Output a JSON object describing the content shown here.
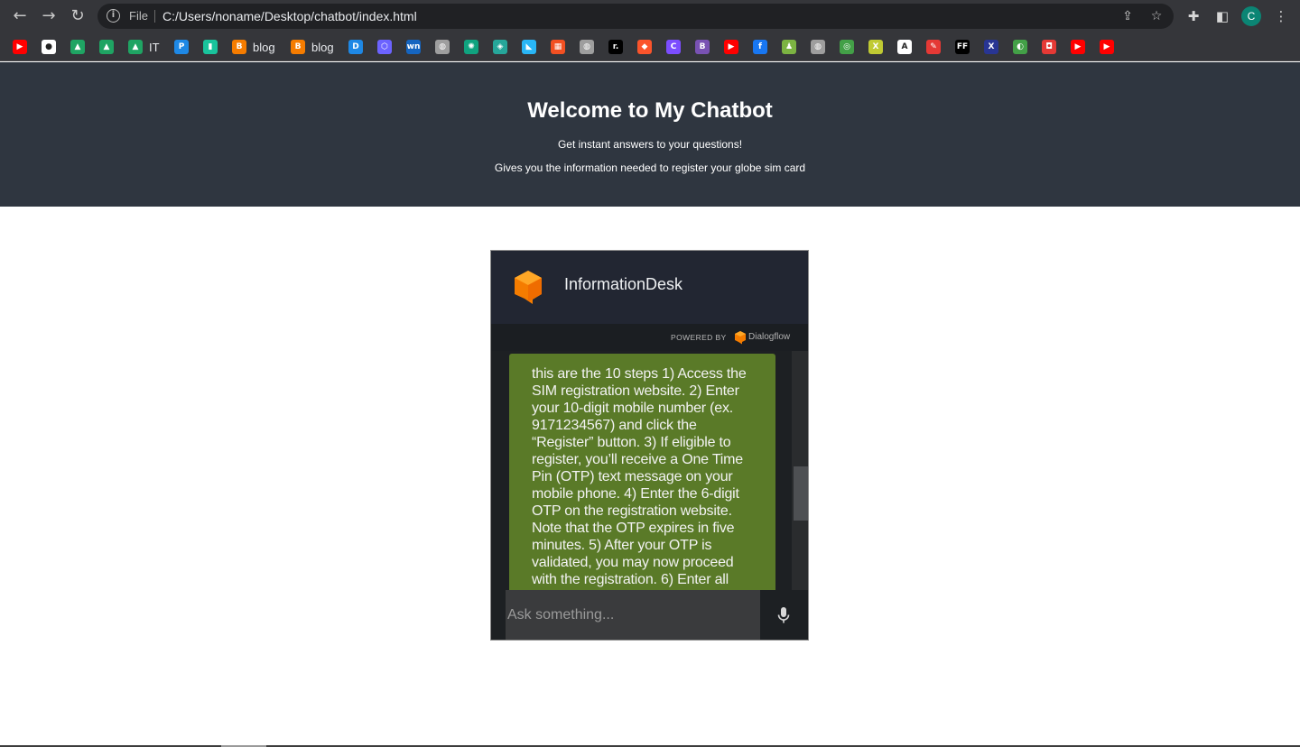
{
  "browser": {
    "file_label": "File",
    "url": "C:/Users/noname/Desktop/chatbot/index.html",
    "profile_initial": "C"
  },
  "bookmarks": [
    {
      "icon": "youtube-icon",
      "color": "#ff0000",
      "glyph": "▶",
      "label": ""
    },
    {
      "icon": "github-icon",
      "color": "#ffffff",
      "glyph": "●",
      "label": ""
    },
    {
      "icon": "google-drive-icon",
      "color": "#1fa463",
      "glyph": "▲",
      "label": ""
    },
    {
      "icon": "google-drive-icon",
      "color": "#1fa463",
      "glyph": "▲",
      "label": ""
    },
    {
      "icon": "google-drive-icon",
      "color": "#1fa463",
      "glyph": "▲",
      "label": "IT"
    },
    {
      "icon": "paypal-icon",
      "color": "#1e88e5",
      "glyph": "P",
      "label": ""
    },
    {
      "icon": "app-icon",
      "color": "#19c39c",
      "glyph": "▮",
      "label": ""
    },
    {
      "icon": "blogger-icon",
      "color": "#f57c00",
      "glyph": "B",
      "label": "blog"
    },
    {
      "icon": "blogger-icon",
      "color": "#f57c00",
      "glyph": "B",
      "label": "blog"
    },
    {
      "icon": "d-icon",
      "color": "#1e88e5",
      "glyph": "D",
      "label": ""
    },
    {
      "icon": "hex-icon",
      "color": "#6c63ff",
      "glyph": "⬡",
      "label": ""
    },
    {
      "icon": "wn-icon",
      "color": "#1565c0",
      "glyph": "wn",
      "label": ""
    },
    {
      "icon": "globe-icon",
      "color": "#9e9e9e",
      "glyph": "◍",
      "label": ""
    },
    {
      "icon": "chatgpt-icon",
      "color": "#10a37f",
      "glyph": "✺",
      "label": ""
    },
    {
      "icon": "cube-icon",
      "color": "#26a69a",
      "glyph": "◈",
      "label": ""
    },
    {
      "icon": "vite-icon",
      "color": "#29b6f6",
      "glyph": "◣",
      "label": ""
    },
    {
      "icon": "microsoft-icon",
      "color": "#f25022",
      "glyph": "▦",
      "label": ""
    },
    {
      "icon": "globe-icon",
      "color": "#9e9e9e",
      "glyph": "◍",
      "label": ""
    },
    {
      "icon": "r-icon",
      "color": "#000000",
      "glyph": "r.",
      "label": ""
    },
    {
      "icon": "brave-icon",
      "color": "#fb542b",
      "glyph": "◆",
      "label": ""
    },
    {
      "icon": "c-icon",
      "color": "#7c4dff",
      "glyph": "C",
      "label": ""
    },
    {
      "icon": "bootstrap-icon",
      "color": "#7952b3",
      "glyph": "B",
      "label": ""
    },
    {
      "icon": "youtube-icon",
      "color": "#ff0000",
      "glyph": "▶",
      "label": ""
    },
    {
      "icon": "facebook-icon",
      "color": "#1877f2",
      "glyph": "f",
      "label": ""
    },
    {
      "icon": "chess-icon",
      "color": "#7cb342",
      "glyph": "♟",
      "label": ""
    },
    {
      "icon": "globe-icon",
      "color": "#9e9e9e",
      "glyph": "◍",
      "label": ""
    },
    {
      "icon": "green-square-icon",
      "color": "#43a047",
      "glyph": "◎",
      "label": ""
    },
    {
      "icon": "x-icon",
      "color": "#c0ca33",
      "glyph": "X",
      "label": ""
    },
    {
      "icon": "a-icon",
      "color": "#ffffff",
      "glyph": "A",
      "label": ""
    },
    {
      "icon": "tool-icon",
      "color": "#e53935",
      "glyph": "✎",
      "label": ""
    },
    {
      "icon": "ff-icon",
      "color": "#000000",
      "glyph": "FF",
      "label": ""
    },
    {
      "icon": "xml-icon",
      "color": "#283593",
      "glyph": "X",
      "label": ""
    },
    {
      "icon": "frog-icon",
      "color": "#43a047",
      "glyph": "◐",
      "label": ""
    },
    {
      "icon": "lock-icon",
      "color": "#e53935",
      "glyph": "◘",
      "label": ""
    },
    {
      "icon": "youtube-icon",
      "color": "#ff0000",
      "glyph": "▶",
      "label": ""
    },
    {
      "icon": "youtube-icon",
      "color": "#ff0000",
      "glyph": "▶",
      "label": ""
    }
  ],
  "hero": {
    "title": "Welcome to My Chatbot",
    "subtitle": "Get instant answers to your questions!",
    "description": "Gives you the information needed to register your globe sim card"
  },
  "chat": {
    "title": "InformationDesk",
    "powered_by": "POWERED BY",
    "powered_name": "Dialogflow",
    "message": "this are the 10 steps 1) Access the SIM registration website. 2) Enter your 10-digit mobile number (ex. 9171234567) and click the “Register” button. 3) If eligible to register, you’ll receive a One Time Pin (OTP) text message on your mobile phone. 4) Enter the 6-digit OTP on the registration website. Note that the OTP expires in five minutes. 5) After your OTP is validated, you may now proceed with the registration. 6) Enter all",
    "input_placeholder": "Ask something...",
    "bubble_color": "#5a7a28",
    "accent_color": "#f57c00"
  }
}
